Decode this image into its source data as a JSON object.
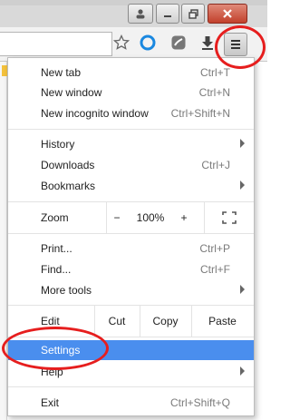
{
  "menu": {
    "group1": [
      {
        "label": "New tab",
        "shortcut": "Ctrl+T"
      },
      {
        "label": "New window",
        "shortcut": "Ctrl+N"
      },
      {
        "label": "New incognito window",
        "shortcut": "Ctrl+Shift+N"
      }
    ],
    "group2": [
      {
        "label": "History",
        "shortcut": ""
      },
      {
        "label": "Downloads",
        "shortcut": "Ctrl+J"
      },
      {
        "label": "Bookmarks",
        "shortcut": ""
      }
    ],
    "zoom": {
      "label": "Zoom",
      "minus": "−",
      "value": "100%",
      "plus": "+"
    },
    "group3": [
      {
        "label": "Print...",
        "shortcut": "Ctrl+P"
      },
      {
        "label": "Find...",
        "shortcut": "Ctrl+F"
      },
      {
        "label": "More tools",
        "shortcut": ""
      }
    ],
    "edit": {
      "label": "Edit",
      "cut": "Cut",
      "copy": "Copy",
      "paste": "Paste"
    },
    "settings": {
      "label": "Settings"
    },
    "help": {
      "label": "Help"
    },
    "exit": {
      "label": "Exit",
      "shortcut": "Ctrl+Shift+Q"
    }
  },
  "colors": {
    "highlight": "#4a8eee",
    "annotation": "#e61e1e"
  },
  "icons": [
    "user-icon",
    "minimize-icon",
    "restore-icon",
    "close-icon",
    "star-icon",
    "opera-icon",
    "extension-icon",
    "download-icon",
    "hamburger-menu-icon",
    "fullscreen-icon"
  ]
}
